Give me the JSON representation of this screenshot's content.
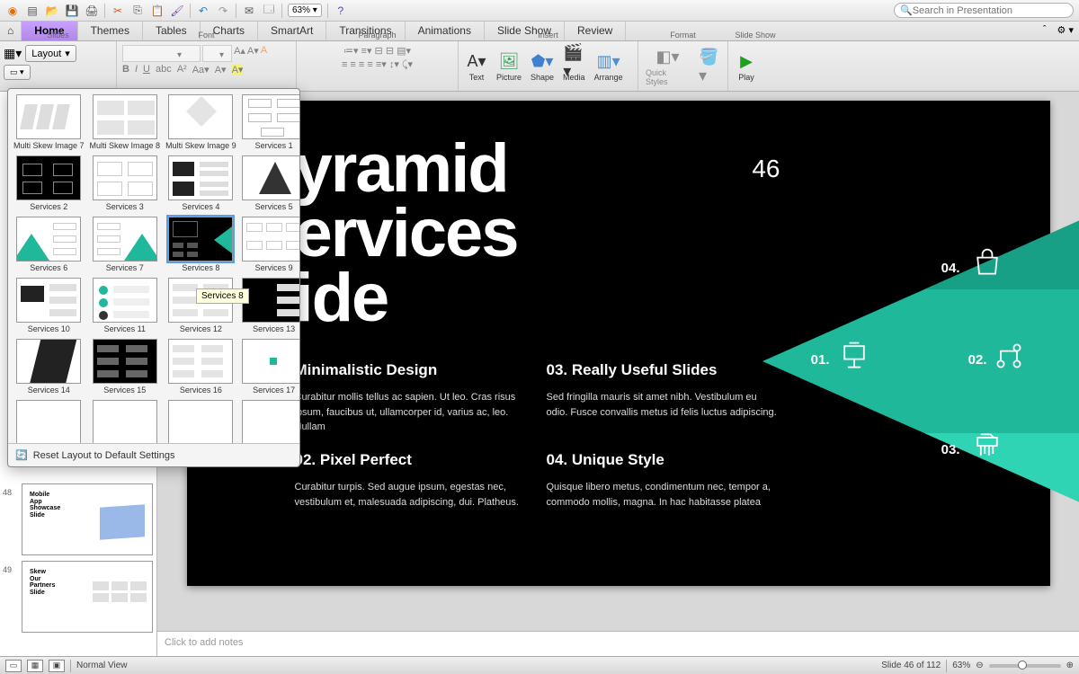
{
  "zoom": "63%",
  "search_placeholder": "Search in Presentation",
  "tabs": [
    "Home",
    "Themes",
    "Tables",
    "Charts",
    "SmartArt",
    "Transitions",
    "Animations",
    "Slide Show",
    "Review"
  ],
  "ribbon": {
    "slides_title": "Slides",
    "layout_btn": "Layout",
    "font_title": "Font",
    "paragraph_title": "Paragraph",
    "insert_title": "Insert",
    "format_title": "Format",
    "slideshow_title": "Slide Show",
    "text_btn": "Text",
    "picture_btn": "Picture",
    "shape_btn": "Shape",
    "media_btn": "Media",
    "arrange_btn": "Arrange",
    "quick_styles_btn": "Quick Styles",
    "play_btn": "Play"
  },
  "sidebar": {
    "thumb_48_num": "48",
    "thumb_48_title": "Mobile\nApp\nShowcase\nSlide",
    "thumb_49_num": "49",
    "thumb_49_title": "Skew\nOur\nPartners\nSlide"
  },
  "slide": {
    "page_num": "46",
    "title_l1": "yramid",
    "title_l2": "ervices",
    "title_l3": "ide",
    "svc1_h": "Minimalistic Design",
    "svc1_p": "Curabitur mollis tellus ac sapien. Ut leo. Cras risus ipsum, faucibus ut, ullamcorper id, varius ac, leo. Nullam",
    "svc2_h": "02. Pixel Perfect",
    "svc2_p": "Curabitur turpis. Sed augue ipsum, egestas nec, vestibulum et, malesuada adipiscing, dui. Platheus.",
    "svc3_h": "03. Really Useful Slides",
    "svc3_p": "Sed fringilla mauris sit amet nibh. Vestibulum eu odio. Fusce convallis metus id felis luctus adipiscing.",
    "svc4_h": "04. Unique Style",
    "svc4_p": "Quisque libero metus, condimentum nec, tempor a, commodo mollis, magna. In hac habitasse platea",
    "tn1": "01.",
    "tn2": "02.",
    "tn3": "03.",
    "tn4": "04."
  },
  "notes_placeholder": "Click to add notes",
  "layout_items": [
    "Multi Skew Image 7",
    "Multi Skew Image 8",
    "Multi Skew Image 9",
    "Services 1",
    "Services 2",
    "Services 3",
    "Services 4",
    "Services 5",
    "Services 6",
    "Services 7",
    "Services 8",
    "Services 9",
    "Services 10",
    "Services 11",
    "Services 12",
    "Services 13",
    "Services 14",
    "Services 15",
    "Services 16",
    "Services 17"
  ],
  "layout_reset": "Reset Layout to Default Settings",
  "tooltip": "Services 8",
  "status": {
    "view": "Normal View",
    "slide_count": "Slide 46 of 112",
    "zoom": "63%"
  }
}
